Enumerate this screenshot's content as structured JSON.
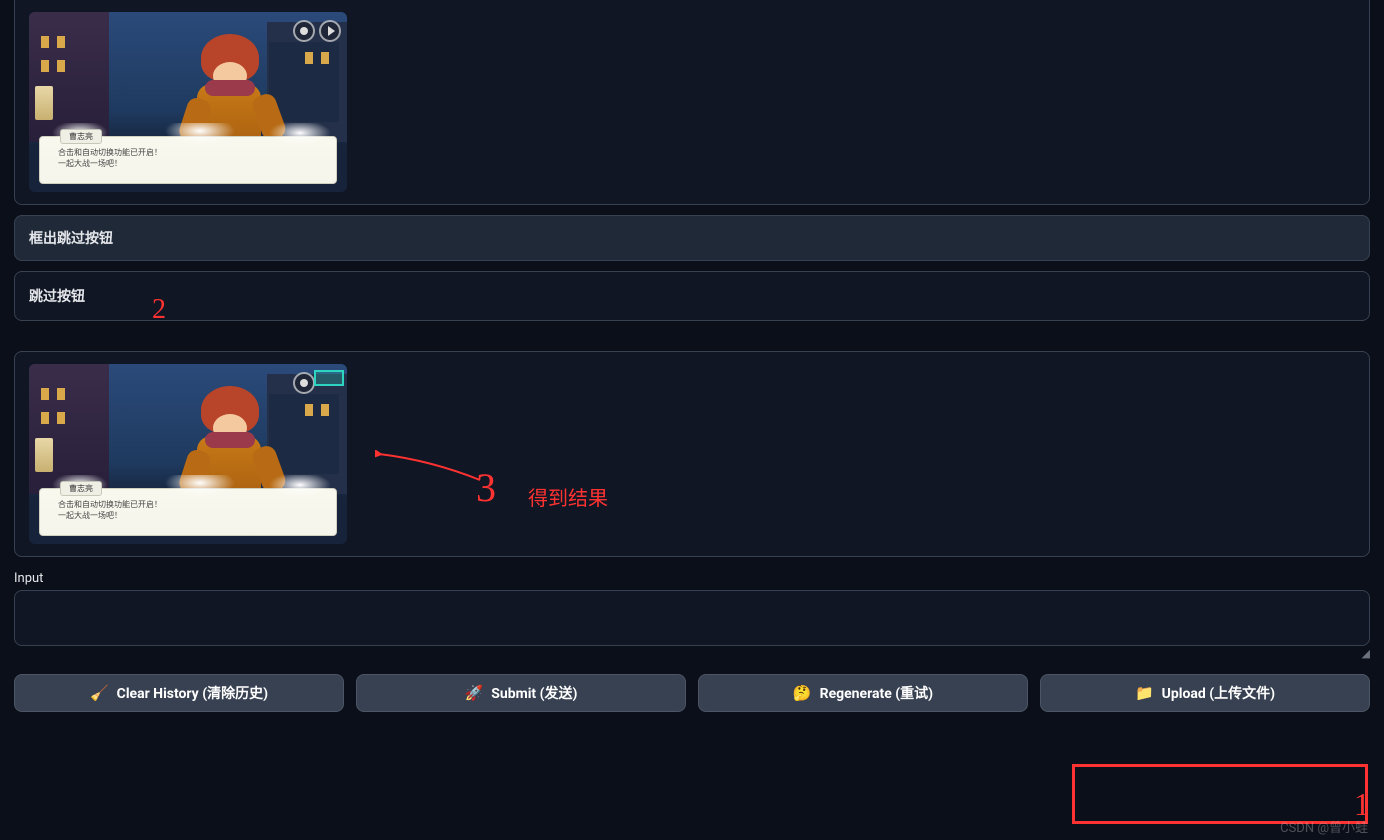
{
  "chat": {
    "messages": [
      {
        "kind": "image",
        "dialog_name": "曹志亮",
        "dialog_line1": "合击和自动切换功能已开启！",
        "dialog_line2": "一起大战一场吧！"
      },
      {
        "kind": "user_text",
        "text": "框出跳过按钮"
      },
      {
        "kind": "assistant_text",
        "text": "跳过按钮"
      },
      {
        "kind": "image",
        "dialog_name": "曹志亮",
        "dialog_line1": "合击和自动切换功能已开启！",
        "dialog_line2": "一起大战一场吧！",
        "result_highlight": true
      }
    ]
  },
  "annotations": {
    "num2": "2",
    "num3": "3",
    "text3": "得到结果",
    "num1": "1"
  },
  "input": {
    "label": "Input",
    "value": ""
  },
  "buttons": {
    "clear": "Clear History (清除历史)",
    "submit": "Submit (发送)",
    "regenerate": "Regenerate (重试)",
    "upload": "Upload (上传文件)"
  },
  "icons": {
    "clear": "🧹",
    "submit": "🚀",
    "regenerate": "🤔",
    "upload": "📁"
  },
  "watermark": "CSDN @曾小蛙"
}
